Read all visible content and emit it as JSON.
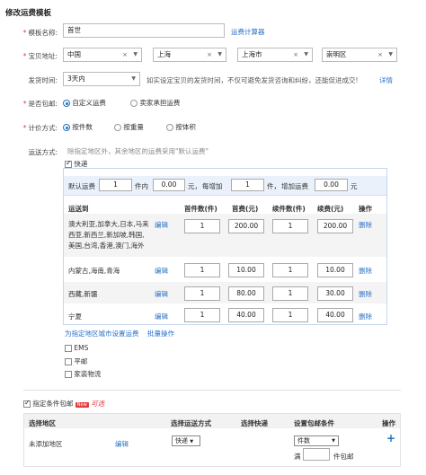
{
  "page_title": "修改运费模板",
  "form": {
    "template_name_label": "模板名称:",
    "template_name_value": "首世",
    "calculator_link": "运费计算器",
    "location_label": "宝贝地址:",
    "country": "中国",
    "province": "上海",
    "city": "上海市",
    "district": "崇明区",
    "ship_time_label": "发货时间:",
    "ship_time_value": "3天内",
    "ship_time_note": "如实设定宝贝的发货时间，不仅可避免发货咨询和纠纷，还能促进成交!",
    "ship_time_link": "详情",
    "free_ship_label": "是否包邮:",
    "free_ship_options": [
      "自定义运费",
      "卖家承担运费"
    ],
    "pricing_label": "计价方式:",
    "pricing_options": [
      "按件数",
      "按重量",
      "按体积"
    ],
    "method_label": "运送方式:",
    "method_hint": "除指定地区外，其余地区的运费采用\"默认运费\""
  },
  "express": {
    "label": "快递",
    "default_row": {
      "prefix": "默认运费",
      "first_qty": "1",
      "unit1": "件内",
      "first_fee": "0.00",
      "unit2": "元，",
      "each_add": "每增加",
      "add_qty": "1",
      "unit3": "件，",
      "add_fee_label": "增加运费",
      "add_fee": "0.00",
      "unit4": "元"
    },
    "headers": [
      "运送到",
      "首件数(件)",
      "首费(元)",
      "续件数(件)",
      "续费(元)",
      "操作"
    ],
    "edit_label": "编辑",
    "delete_label": "删除",
    "rows": [
      {
        "area": "澳大利亚,加拿大,日本,马来西亚,新西兰,新加坡,韩国,美国,台湾,香港,澳门,海外",
        "first": "1",
        "first_fee": "200.00",
        "add": "1",
        "add_fee": "200.00"
      },
      {
        "area": "内蒙古,海南,青海",
        "first": "1",
        "first_fee": "10.00",
        "add": "1",
        "add_fee": "10.00"
      },
      {
        "area": "西藏,新疆",
        "first": "1",
        "first_fee": "80.00",
        "add": "1",
        "add_fee": "30.00"
      },
      {
        "area": "宁夏",
        "first": "1",
        "first_fee": "40.00",
        "add": "1",
        "add_fee": "40.00"
      }
    ],
    "footer_link1": "为指定地区城市设置运费",
    "footer_link2": "批量操作"
  },
  "other_methods": [
    "EMS",
    "平邮",
    "家装物流"
  ],
  "conditional_free": {
    "label": "指定条件包邮",
    "badge": "New",
    "optional": "可选",
    "headers": [
      "选择地区",
      "选择运送方式",
      "选择快递",
      "设置包邮条件",
      "操作"
    ],
    "row": {
      "area": "未添加地区",
      "edit": "编辑",
      "method": "快递",
      "condition_type": "件数",
      "full_prefix": "满",
      "full_suffix": "件包邮",
      "add_icon": "+"
    }
  }
}
